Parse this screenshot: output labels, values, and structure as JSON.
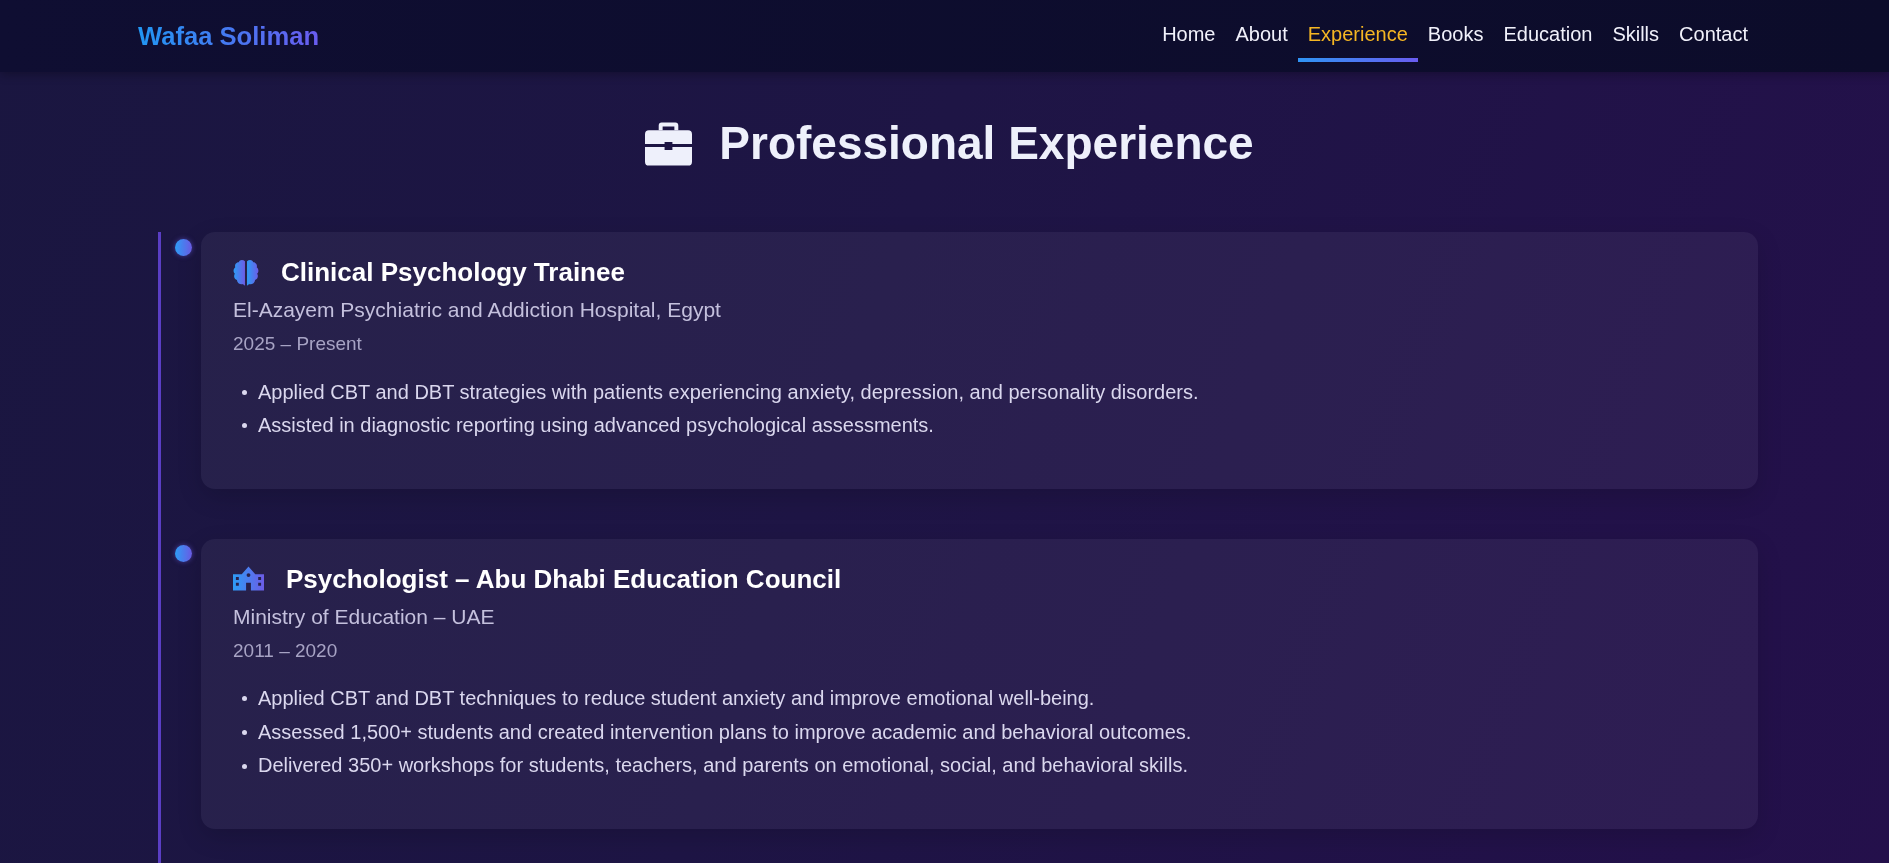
{
  "navbar": {
    "brand": "Wafaa Soliman",
    "links": [
      {
        "label": "Home",
        "selected": false
      },
      {
        "label": "About",
        "selected": false
      },
      {
        "label": "Experience",
        "selected": true
      },
      {
        "label": "Books",
        "selected": false
      },
      {
        "label": "Education",
        "selected": false
      },
      {
        "label": "Skills",
        "selected": false
      },
      {
        "label": "Contact",
        "selected": false
      }
    ]
  },
  "section": {
    "title": "Professional Experience"
  },
  "experience": [
    {
      "kind": "clinical",
      "title": "Clinical Psychology Trainee",
      "organization": "El-Azayem Psychiatric and Addiction Hospital, Egypt",
      "period": "2025 – Present",
      "duties": [
        "Applied CBT and DBT strategies with patients experiencing anxiety, depression, and personality disorders.",
        "Assisted in diagnostic reporting using advanced psychological assessments."
      ]
    },
    {
      "kind": "school",
      "title": "Psychologist – Abu Dhabi Education Council",
      "organization": "Ministry of Education – UAE",
      "period": "2011 – 2020",
      "duties": [
        "Applied CBT and DBT techniques to reduce student anxiety and improve emotional well-being.",
        "Assessed 1,500+ students and created intervention plans to improve academic and behavioral outcomes.",
        "Delivered 350+ workshops for students, teachers, and parents on emotional, social, and behavioral skills."
      ]
    }
  ]
}
